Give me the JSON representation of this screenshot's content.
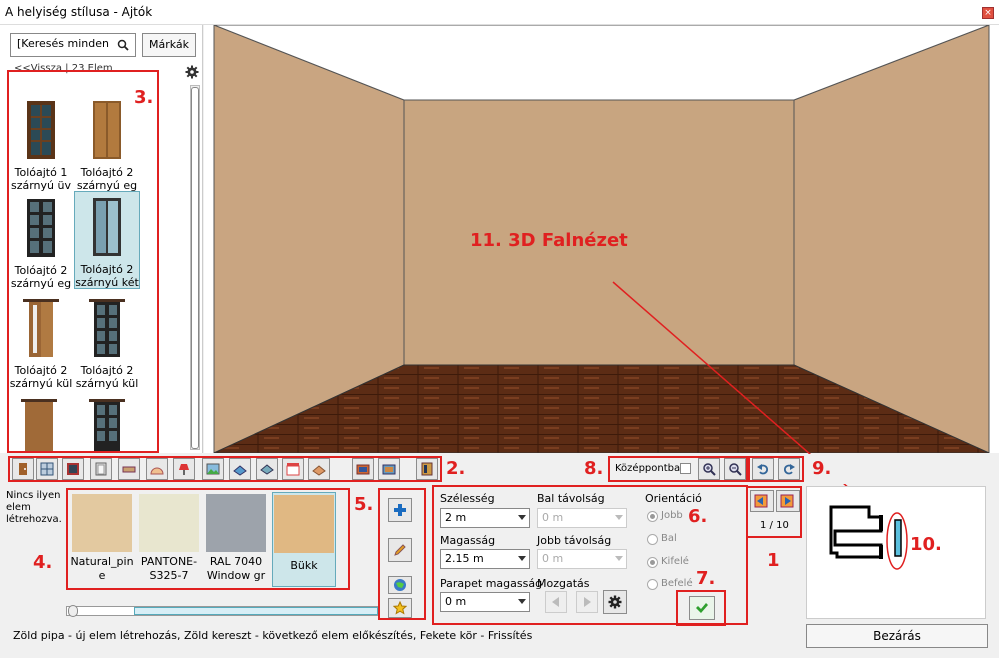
{
  "window": {
    "title": "A helyiség stílusa - Ajtók"
  },
  "catalog": {
    "search_value": "[Keresés minden",
    "brands_label": "Márkák",
    "back_label": "<<Vissza",
    "count_label": "23 Elem",
    "items": [
      {
        "line1": "Tolóajtó 1",
        "line2": "szárnyú üv"
      },
      {
        "line1": "Tolóajtó 2",
        "line2": "szárnyú eg"
      },
      {
        "line1": "Tolóajtó 2",
        "line2": "szárnyú eg"
      },
      {
        "line1": "Tolóajtó 2",
        "line2": "szárnyú két"
      },
      {
        "line1": "Tolóajtó 2",
        "line2": "szárnyú kül"
      },
      {
        "line1": "Tolóajtó 2",
        "line2": "szárnyú kül"
      }
    ]
  },
  "annotations": {
    "n1": "1",
    "n2": "2.",
    "n3": "3.",
    "n4": "4.",
    "n5": "5.",
    "n6": "6.",
    "n7": "7.",
    "n8": "8.",
    "n9": "9.",
    "n10": "10.",
    "n11": "11. 3D Falnézet"
  },
  "toolbar": {
    "center_label": "Középpontba"
  },
  "materials": {
    "empty_text": [
      "Nincs ilyen",
      "elem",
      "létrehozva."
    ],
    "items": [
      {
        "line1": "Natural_pin",
        "line2": "e",
        "color": "#e3c9a0"
      },
      {
        "line1": "PANTONE-",
        "line2": "S325-7",
        "color": "#e8e6cf"
      },
      {
        "line1": "RAL 7040",
        "line2": "Window gr",
        "color": "#9da3ab"
      },
      {
        "line1": "Bükk",
        "line2": "",
        "color": "#e0b883"
      }
    ]
  },
  "form": {
    "width_label": "Szélesség",
    "width_value": "2 m",
    "left_dist_label": "Bal távolság",
    "left_dist_value": "0 m",
    "orientation_label": "Orientáció",
    "height_label": "Magasság",
    "height_value": "2.15 m",
    "right_dist_label": "Jobb távolság",
    "right_dist_value": "0 m",
    "parapet_label": "Parapet magasság",
    "parapet_value": "0 m",
    "move_label": "Mozgatás",
    "radio_right": "Jobb",
    "radio_left": "Bal",
    "radio_out": "Kifelé",
    "radio_in": "Befelé"
  },
  "pager": {
    "label": "1 / 10"
  },
  "status": "Zöld pipa - új elem létrehozás, Zöld kereszt - következő elem előkészítés, Fekete kör - Frissítés",
  "close_label": "Bezárás",
  "colors": {
    "accent_red": "#e02020",
    "wall": "#c8a580",
    "floor": "#5a2a14"
  }
}
